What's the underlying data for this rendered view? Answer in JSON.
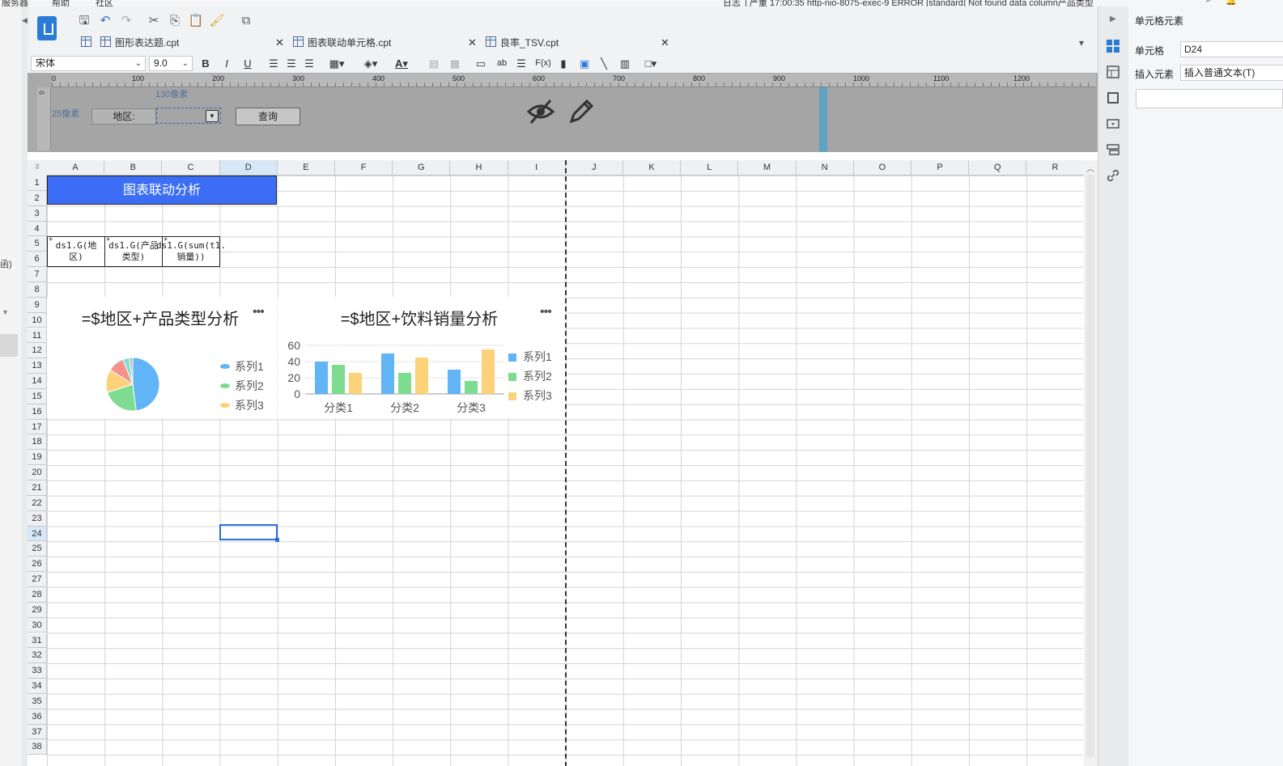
{
  "menubar": {
    "items": [
      "服务器",
      "帮助",
      "社区"
    ],
    "log_label": "日志",
    "log_text": "| 严重 17:00:35 http-nio-8075-exec-9 ERROR [standard] Not found data column产品类型"
  },
  "left_stub": {
    "fragment": "函)"
  },
  "tabs": [
    {
      "label": "图形表达题.cpt"
    },
    {
      "label": "图表联动单元格.cpt"
    },
    {
      "label": "良率_TSV.cpt"
    }
  ],
  "format": {
    "font_name": "宋体",
    "font_size": "9.0",
    "bold": "B",
    "italic": "I",
    "underline": "U",
    "font_color": "A",
    "text_btn": "ab",
    "formula": "F(x)"
  },
  "param_pane": {
    "ruler_marks": [
      "0",
      "100",
      "200",
      "300",
      "400",
      "500",
      "600",
      "700",
      "800",
      "900",
      "1000",
      "1100",
      "1200"
    ],
    "vruler_mark": "0",
    "height_label": "25像素",
    "width_label": "130像素",
    "region_label": "地区:",
    "query_button": "查询"
  },
  "grid": {
    "corner": "⠿",
    "columns": [
      "A",
      "B",
      "C",
      "D",
      "E",
      "F",
      "G",
      "H",
      "I",
      "J",
      "K",
      "L",
      "M",
      "N",
      "O",
      "P",
      "Q",
      "R"
    ],
    "selected_column": "D",
    "rows": [
      "1",
      "2",
      "3",
      "4",
      "5",
      "6",
      "7",
      "8",
      "9",
      "10",
      "11",
      "12",
      "13",
      "14",
      "15",
      "16",
      "17",
      "18",
      "19",
      "20",
      "21",
      "22",
      "23",
      "24",
      "25",
      "26",
      "27",
      "28",
      "29",
      "30",
      "31",
      "32",
      "33",
      "34",
      "35",
      "36",
      "37",
      "38"
    ],
    "selected_row": "24",
    "title_cell": "图表联动分析",
    "ds_cells": [
      "ds1.G(地区)",
      "ds1.G(产品类型)",
      "ds1.G(sum(t1.销量))"
    ]
  },
  "pie_chart": {
    "title": "=$地区+产品类型分析",
    "more": "•••",
    "legend": [
      "系列1",
      "系列2",
      "系列3"
    ]
  },
  "bar_chart": {
    "title": "=$地区+饮料销量分析",
    "more": "•••",
    "legend": [
      "系列1",
      "系列2",
      "系列3"
    ],
    "categories": [
      "分类1",
      "分类2",
      "分类3"
    ],
    "yticks": [
      "60",
      "40",
      "20",
      "0"
    ]
  },
  "chart_data": [
    {
      "type": "pie",
      "title": "=$地区+产品类型分析",
      "labels": [
        "系列1",
        "系列2",
        "系列3"
      ],
      "slices": [
        {
          "label": "系列1",
          "value": 48,
          "color": "#61b4f5"
        },
        {
          "label": "系列2",
          "value": 22,
          "color": "#7ddc8f"
        },
        {
          "label": "系列3",
          "value": 14,
          "color": "#fbd27a"
        },
        {
          "label": "",
          "value": 10,
          "color": "#f3938c"
        },
        {
          "label": "",
          "value": 4,
          "color": "#7ee0d3"
        },
        {
          "label": "",
          "value": 2,
          "color": "#b9b9b9"
        }
      ]
    },
    {
      "type": "bar",
      "title": "=$地区+饮料销量分析",
      "categories": [
        "分类1",
        "分类2",
        "分类3"
      ],
      "ylim": [
        0,
        60
      ],
      "yticks": [
        0,
        20,
        40,
        60
      ],
      "series": [
        {
          "name": "系列1",
          "values": [
            40,
            50,
            30
          ],
          "color": "#61b4f5"
        },
        {
          "name": "系列2",
          "values": [
            36,
            26,
            16
          ],
          "color": "#7ddc8f"
        },
        {
          "name": "系列3",
          "values": [
            26,
            45,
            55
          ],
          "color": "#fbd27a"
        }
      ]
    }
  ],
  "properties": {
    "title": "单元格元素",
    "cell_label": "单元格",
    "cell_value": "D24",
    "insert_label": "插入元素",
    "insert_value": "插入普通文本(T)"
  },
  "colors": {
    "accent": "#2d6fdc",
    "title_cell_bg": "#3b6ef5",
    "param_bg": "#a9a9a9"
  }
}
